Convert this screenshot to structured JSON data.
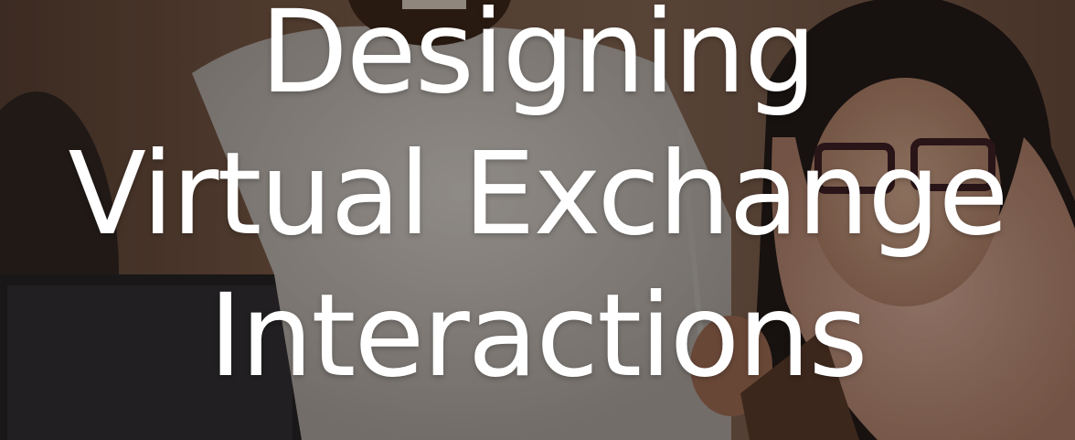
{
  "hero": {
    "title_lines": [
      "Designing",
      "Virtual Exchange",
      "Interactions"
    ]
  },
  "colors": {
    "title": "#ffffff",
    "overlay": "rgba(20,14,10,0.42)"
  }
}
